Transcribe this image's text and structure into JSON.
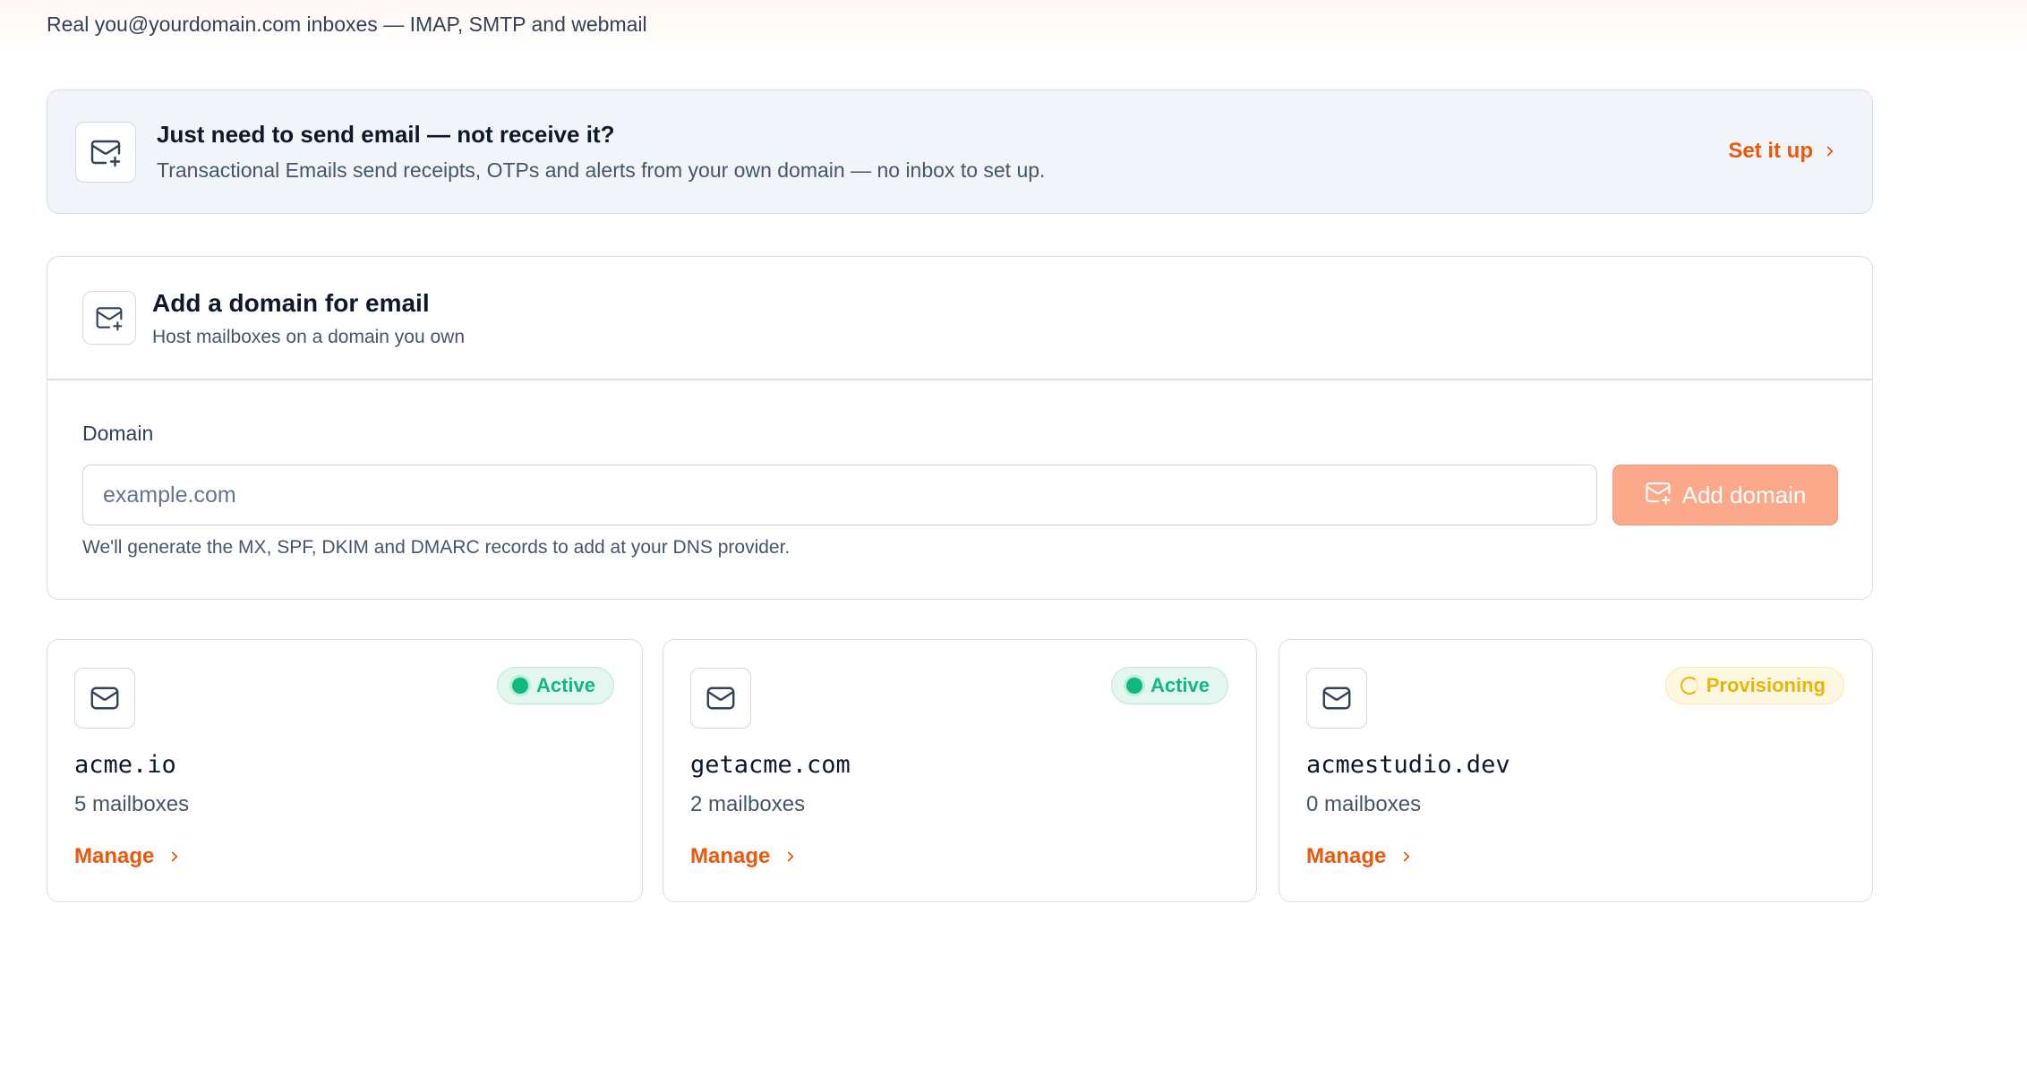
{
  "header": {
    "subtitle": "Real you@yourdomain.com inboxes — IMAP, SMTP and webmail"
  },
  "banner": {
    "icon": "mail-plus-icon",
    "title": "Just need to send email — not receive it?",
    "description": "Transactional Emails send receipts, OTPs and alerts from your own domain — no inbox to set up.",
    "link_label": "Set it up"
  },
  "add_domain": {
    "icon": "mail-plus-icon",
    "title": "Add a domain for email",
    "description": "Host mailboxes on a domain you own",
    "field_label": "Domain",
    "input_value": "",
    "input_placeholder": "example.com",
    "button_label": "Add domain",
    "help_text": "We'll generate the MX, SPF, DKIM and DMARC records to add at your DNS provider."
  },
  "domains": [
    {
      "name": "acme.io",
      "mailboxes": "5 mailboxes",
      "status": "Active",
      "status_type": "active",
      "action": "Manage"
    },
    {
      "name": "getacme.com",
      "mailboxes": "2 mailboxes",
      "status": "Active",
      "status_type": "active",
      "action": "Manage"
    },
    {
      "name": "acmestudio.dev",
      "mailboxes": "0 mailboxes",
      "status": "Provisioning",
      "status_type": "provisioning",
      "action": "Manage"
    }
  ],
  "colors": {
    "accent": "#ea580c",
    "accent_disabled": "#fba98a",
    "active": "#10b981",
    "provisioning": "#eab308"
  }
}
